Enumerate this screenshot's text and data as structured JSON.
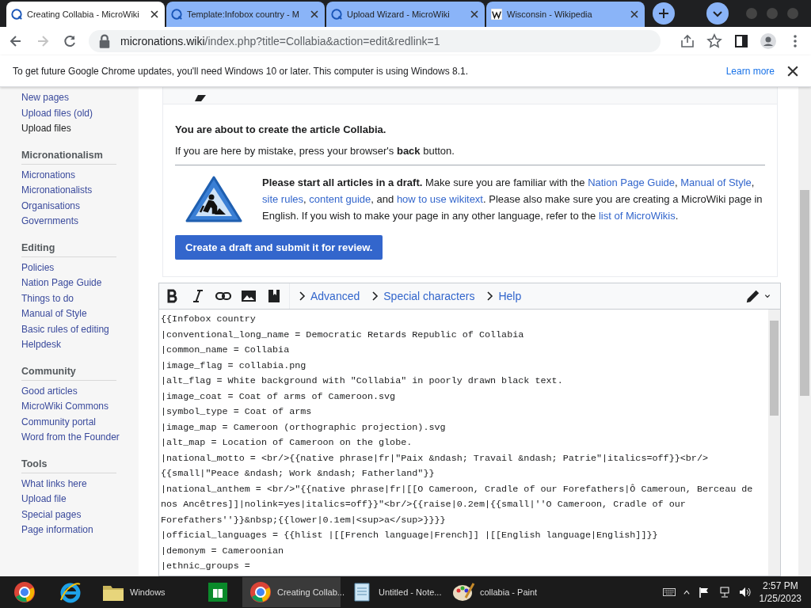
{
  "browser": {
    "tabs": [
      {
        "title": "Creating Collabia - MicroWiki",
        "kind": "wiki",
        "selected": true
      },
      {
        "title": "Template:Infobox country - M",
        "kind": "wiki",
        "selected": false
      },
      {
        "title": "Upload Wizard - MicroWiki",
        "kind": "wiki",
        "selected": false
      },
      {
        "title": "Wisconsin - Wikipedia",
        "kind": "wikipedia",
        "selected": false
      }
    ],
    "address": {
      "host": "micronations.wiki",
      "path": "/index.php?title=Collabia&action=edit&redlink=1"
    },
    "infobar": {
      "message": "To get future Google Chrome updates, you'll need Windows 10 or later. This computer is using Windows 8.1.",
      "link": "Learn more"
    }
  },
  "sidebar": {
    "groups": [
      {
        "items": [
          {
            "label": "New pages",
            "selected": false
          },
          {
            "label": "Upload files (old)",
            "selected": false
          },
          {
            "label": "Upload files",
            "selected": true
          }
        ]
      },
      {
        "heading": "Micronationalism",
        "items": [
          {
            "label": "Micronations",
            "selected": false
          },
          {
            "label": "Micronationalists",
            "selected": false
          },
          {
            "label": "Organisations",
            "selected": false
          },
          {
            "label": "Governments",
            "selected": false
          }
        ]
      },
      {
        "heading": "Editing",
        "items": [
          {
            "label": "Policies",
            "selected": false
          },
          {
            "label": "Nation Page Guide",
            "selected": false
          },
          {
            "label": "Things to do",
            "selected": false
          },
          {
            "label": "Manual of Style",
            "selected": false
          },
          {
            "label": "Basic rules of editing",
            "selected": false
          },
          {
            "label": "Helpdesk",
            "selected": false
          }
        ]
      },
      {
        "heading": "Community",
        "items": [
          {
            "label": "Good articles",
            "selected": false
          },
          {
            "label": "MicroWiki Commons",
            "selected": false
          },
          {
            "label": "Community portal",
            "selected": false
          },
          {
            "label": "Word from the Founder",
            "selected": false
          }
        ]
      },
      {
        "heading": "Tools",
        "items": [
          {
            "label": "What links here",
            "selected": false
          },
          {
            "label": "Upload file",
            "selected": false
          },
          {
            "label": "Special pages",
            "selected": false
          },
          {
            "label": "Page information",
            "selected": false
          }
        ]
      }
    ]
  },
  "notice": {
    "intro": "You are about to create the article Collabia.",
    "mistake": "If you are here by mistake, press your browser's **back** button.",
    "draft": [
      {
        "kind": "bold",
        "text": "Please start all articles in a draft."
      },
      {
        "kind": "plain",
        "text": " Make sure you are familiar with the "
      },
      {
        "kind": "link",
        "text": "Nation Page Guide"
      },
      {
        "kind": "plain",
        "text": ", "
      },
      {
        "kind": "link",
        "text": "Manual of Style"
      },
      {
        "kind": "plain",
        "text": ", "
      },
      {
        "kind": "link",
        "text": "site rules"
      },
      {
        "kind": "plain",
        "text": ", "
      },
      {
        "kind": "link",
        "text": "content guide"
      },
      {
        "kind": "plain",
        "text": ", and "
      },
      {
        "kind": "link",
        "text": "how to use wikitext"
      },
      {
        "kind": "plain",
        "text": ". Please also make sure you are creating a MicroWiki page in English. If you wish to make your page in any other language, refer to the "
      },
      {
        "kind": "link",
        "text": "list of MicroWikis"
      },
      {
        "kind": "plain",
        "text": "."
      }
    ],
    "button": "Create a draft and submit it for review."
  },
  "toolbar": {
    "tools": [
      {
        "kind": "bold"
      },
      {
        "kind": "italic"
      },
      {
        "kind": "link"
      },
      {
        "kind": "image"
      },
      {
        "kind": "reference"
      }
    ],
    "sections": [
      "Advanced",
      "Special characters",
      "Help"
    ]
  },
  "editor": {
    "lines": [
      "{{Infobox country",
      "|conventional_long_name = Democratic Retards Republic of Collabia",
      "|common_name = Collabia",
      "|image_flag = collabia.png",
      "|alt_flag = White background with \"Collabia\" in poorly drawn black text.",
      "|image_coat = Coat of arms of Cameroon.svg",
      "|symbol_type = Coat of arms",
      "|image_map = Cameroon (orthographic projection).svg",
      "|alt_map = Location of Cameroon on the globe.",
      "|national_motto = <br/>{{native phrase|fr|\"Paix &ndash; Travail &ndash; Patrie\"|italics=off}}<br/>",
      "{{small|\"Peace &ndash; Work &ndash; Fatherland\"}}",
      "|national_anthem = <br/>\"{{native phrase|fr|[[O Cameroon, Cradle of our Forefathers|Ô Cameroun, Berceau de",
      "nos Ancêtres]]|nolink=yes|italics=off}}\"<br/>{{raise|0.2em|{{small|''O Cameroon, Cradle of our",
      "Forefathers''}}&nbsp;{{lower|0.1em|<sup>a</sup>}}}}",
      "|official_languages = {{hlist |[[French language|French]] |[[English language|English]]}}",
      "|demonym = Cameroonian",
      "|ethnic_groups ="
    ]
  },
  "taskbar": {
    "items": [
      {
        "kind": "chrome",
        "selected": false
      },
      {
        "kind": "ie",
        "selected": false
      },
      {
        "kind": "folder",
        "label": "Windows",
        "selected": false
      },
      {
        "kind": "store",
        "selected": false
      },
      {
        "kind": "chrome",
        "label": "Creating Collab...",
        "selected": true
      },
      {
        "kind": "notepad",
        "label": "Untitled - Note...",
        "selected": false
      },
      {
        "kind": "paint",
        "label": "collabia - Paint",
        "selected": false
      }
    ],
    "time": "2:57 PM",
    "date": "1/25/2023"
  }
}
